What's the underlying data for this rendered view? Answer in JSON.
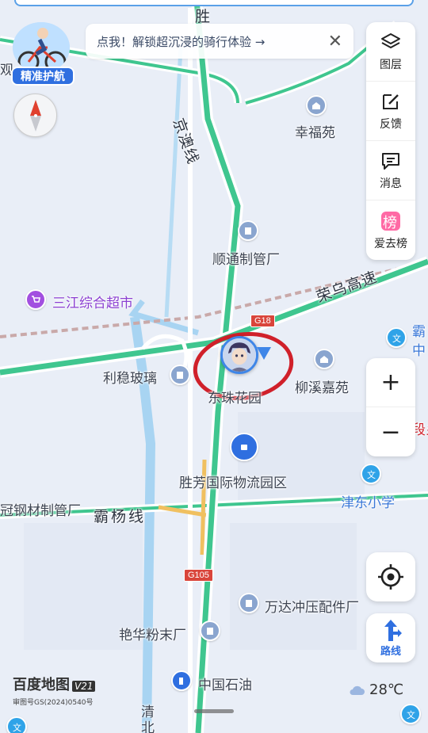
{
  "top_banner": {
    "text": "点我！解锁超沉浸的骑行体验 →",
    "close": "✕"
  },
  "avatar_badge": "精准护航",
  "toolbar": {
    "layers": "图层",
    "feedback": "反馈",
    "messages": "消息",
    "ranking": "爱去榜",
    "ranking_icon_char": "榜"
  },
  "zoom": {
    "in": "+",
    "out": "−"
  },
  "route_button": "路线",
  "map_labels": {
    "top_partial": "胜",
    "left_partial": "观",
    "xingfuyuan": "幸福苑",
    "jingao": "京澳线",
    "shuntong": "顺通制管厂",
    "sanjiang": "三江综合超市",
    "rongwu": "荣乌高速",
    "baxian_partial": "霸",
    "zhong_partial": "中",
    "liwen": "利稳玻璃",
    "liuxi": "柳溪嘉苑",
    "zhuhuayuan": "东珠花园",
    "right_red_partial": "段乡",
    "shengfang": "胜芳国际物流园区",
    "jindong": "津东小学",
    "gangcai": "冠钢材制管厂",
    "bayang": "霸杨线",
    "wanda": "万达冲压配件厂",
    "yanhua": "艳华粉末厂",
    "zhongshiyou": "中国石油",
    "qing_partial": "清",
    "bei_partial": "北"
  },
  "shields": {
    "g18": "G18",
    "g105": "G105"
  },
  "footer": {
    "brand": "百度地图",
    "version": "V21",
    "approval": "审图号GS(2024)0540号",
    "temperature": "28℃"
  },
  "colors": {
    "map_bg": "#e9eef7",
    "highway": "#3fc68f",
    "water": "#9fd0f0",
    "accent": "#2f6fe0",
    "annotation": "#d0202a"
  }
}
